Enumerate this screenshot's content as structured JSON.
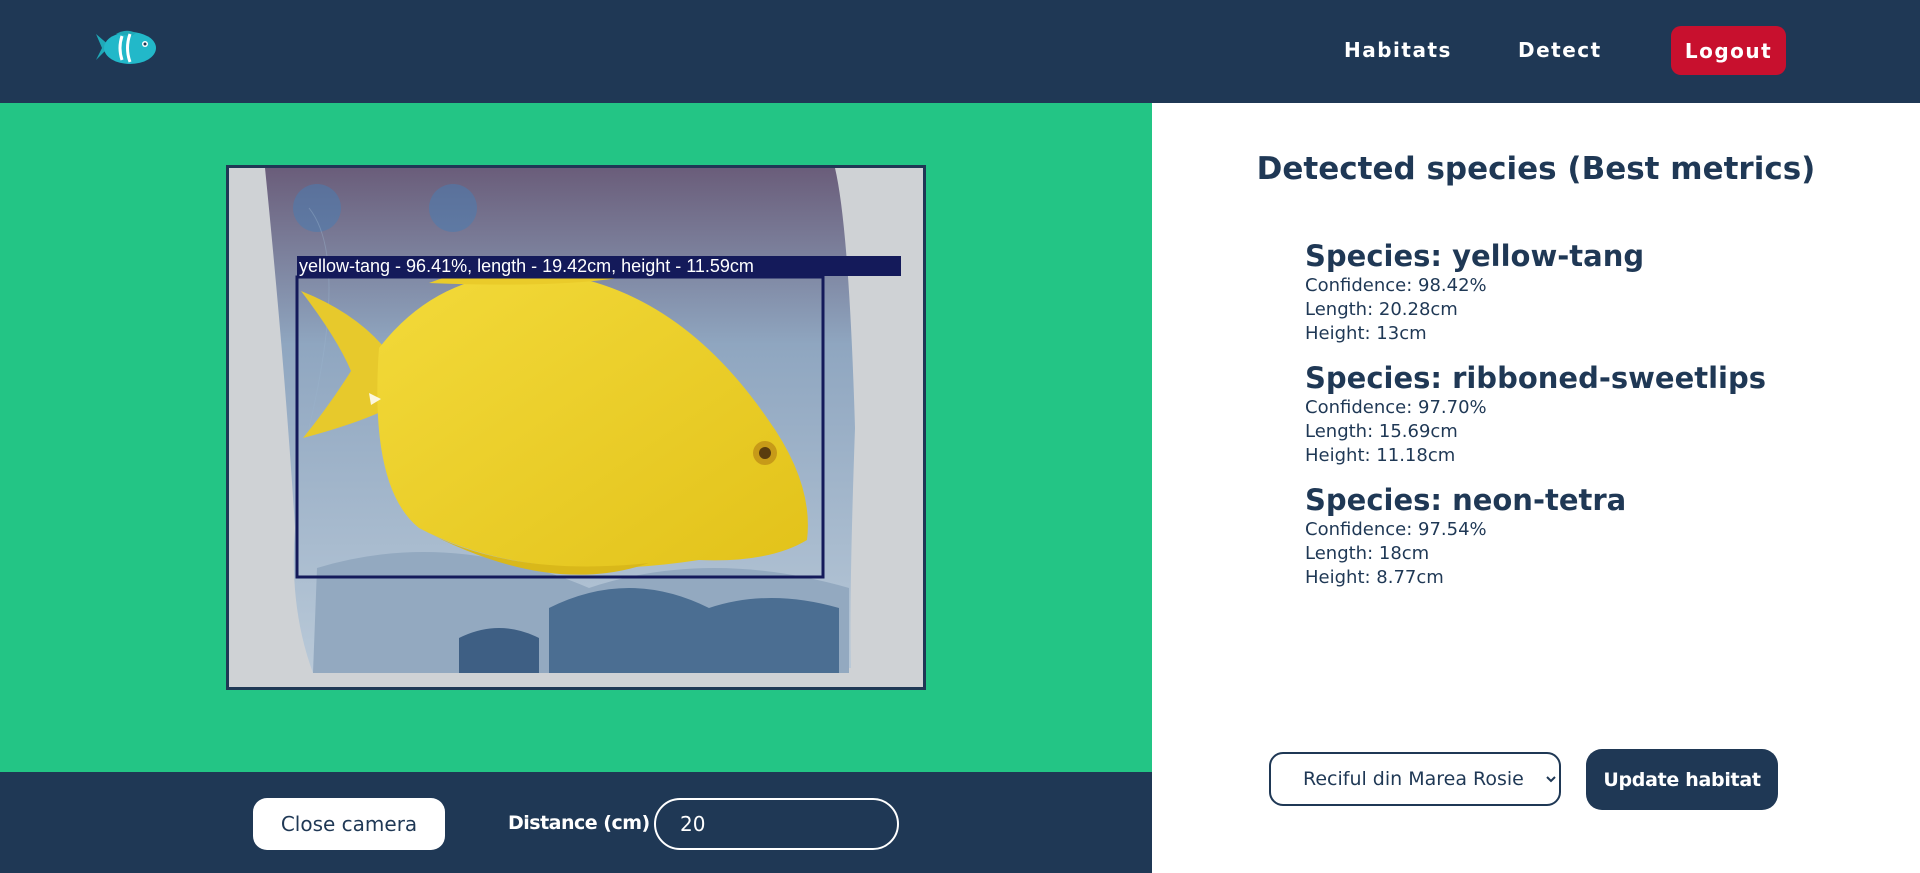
{
  "nav": {
    "links": [
      "Habitats",
      "Detect"
    ],
    "logout_label": "Logout"
  },
  "camera": {
    "overlay_label": "yellow-tang - 96.41%, length - 19.42cm, height - 11.59cm"
  },
  "controls": {
    "close_camera_label": "Close camera",
    "distance_label": "Distance (cm)",
    "distance_value": "20"
  },
  "results": {
    "title": "Detected species (Best metrics)",
    "species": [
      {
        "name": "Species: yellow-tang",
        "confidence": "Confidence: 98.42%",
        "length": "Length: 20.28cm",
        "height": "Height: 13cm"
      },
      {
        "name": "Species: ribboned-sweetlips",
        "confidence": "Confidence: 97.70%",
        "length": "Length: 15.69cm",
        "height": "Height: 11.18cm"
      },
      {
        "name": "Species: neon-tetra",
        "confidence": "Confidence: 97.54%",
        "length": "Length: 18cm",
        "height": "Height: 8.77cm"
      }
    ]
  },
  "habitat": {
    "selected": "Reciful din Marea Rosie",
    "update_label": "Update habitat"
  },
  "colors": {
    "navy": "#1f3855",
    "green": "#23c585",
    "red": "#c8102e"
  }
}
